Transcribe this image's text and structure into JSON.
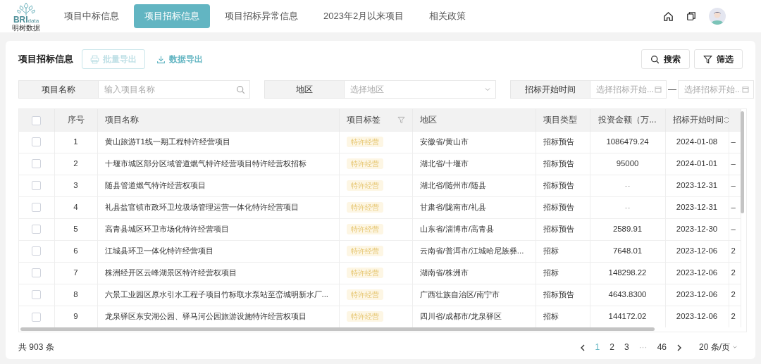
{
  "nav": {
    "logo": {
      "text": "BRI",
      "suffix": "data",
      "caption": "明树数据"
    },
    "tabs": [
      {
        "label": "项目中标信息",
        "selected": false
      },
      {
        "label": "项目招标信息",
        "selected": true
      },
      {
        "label": "项目招标异常信息",
        "selected": false
      },
      {
        "label": "2023年2月以来项目",
        "selected": false
      },
      {
        "label": "相关政策",
        "selected": false
      }
    ]
  },
  "panel": {
    "title": "项目招标信息",
    "buttons": [
      {
        "label": "批量导出",
        "kind": "print",
        "disabled": true
      },
      {
        "label": "数据导出",
        "kind": "download",
        "disabled": false
      }
    ],
    "actions": [
      {
        "label": "搜索",
        "kind": "search"
      },
      {
        "label": "筛选",
        "kind": "filter"
      }
    ]
  },
  "filters": [
    {
      "label": "项目名称",
      "kind": "text",
      "placeholder": "输入项目名称"
    },
    {
      "label": "地区",
      "kind": "select",
      "placeholder": "选择地区"
    },
    {
      "label": "招标开始时间",
      "kind": "daterange",
      "start_placeholder": "选择招标开始...",
      "separator": "—",
      "end_placeholder": "选择招标开始..."
    }
  ],
  "table": {
    "header_checked": false,
    "columns": [
      {
        "kind": "checkbox"
      },
      {
        "kind": "index",
        "label": "序号"
      },
      {
        "kind": "text",
        "label": "项目名称"
      },
      {
        "kind": "tag",
        "label": "项目标签",
        "filter": true
      },
      {
        "kind": "text",
        "label": "地区"
      },
      {
        "kind": "text",
        "label": "项目类型"
      },
      {
        "kind": "number",
        "label": "投资金额（万..."
      },
      {
        "kind": "date",
        "label": "招标开始时间",
        "sortable": true
      },
      {
        "kind": "cut"
      }
    ],
    "rows": [
      {
        "checked": false,
        "cells": [
          "",
          "1",
          "黄山旅游T1线一期工程特许经营项目",
          "特许经营",
          "安徽省/黄山市",
          "招标预告",
          "1086479.24",
          "2024-01-08",
          "–"
        ]
      },
      {
        "checked": false,
        "cells": [
          "",
          "2",
          "十堰市城区部分区域管道燃气特许经营项目特许经营权招标",
          "特许经营",
          "湖北省/十堰市",
          "招标预告",
          "95000",
          "2024-01-01",
          "–"
        ]
      },
      {
        "checked": false,
        "cells": [
          "",
          "3",
          "随县管道燃气特许经营权项目",
          "特许经营",
          "湖北省/随州市/随县",
          "招标预告",
          "--",
          "2023-12-31",
          "–"
        ]
      },
      {
        "checked": false,
        "cells": [
          "",
          "4",
          "礼县盐官镇市政环卫垃圾场管理运营一体化特许经营项目",
          "特许经营",
          "甘肃省/陇南市/礼县",
          "招标预告",
          "--",
          "2023-12-31",
          "–"
        ]
      },
      {
        "checked": false,
        "cells": [
          "",
          "5",
          "高青县城区环卫市场化特许经营项目",
          "特许经营",
          "山东省/淄博市/高青县",
          "招标预告",
          "2589.91",
          "2023-12-30",
          "–"
        ]
      },
      {
        "checked": false,
        "cells": [
          "",
          "6",
          "江城县环卫一体化特许经营项目",
          "特许经营",
          "云南省/普洱市/江城哈尼族彝...",
          "招标",
          "7648.01",
          "2023-12-06",
          "2"
        ]
      },
      {
        "checked": false,
        "cells": [
          "",
          "7",
          "株洲经开区云峰湖景区特许经营权项目",
          "特许经营",
          "湖南省/株洲市",
          "招标",
          "148298.22",
          "2023-12-06",
          "2"
        ]
      },
      {
        "checked": false,
        "cells": [
          "",
          "8",
          "六景工业园区原水引水工程子项目竹标取水泵站至峦城明新水厂...",
          "特许经营",
          "广西壮族自治区/南宁市",
          "招标预告",
          "4643.8300",
          "2023-12-06",
          "2"
        ]
      },
      {
        "checked": false,
        "cells": [
          "",
          "9",
          "龙泉驿区东安湖公园、驿马河公园旅游设施特许经营权项目",
          "特许经营",
          "四川省/成都市/龙泉驿区",
          "招标",
          "144172.02",
          "2023-12-06",
          "2"
        ]
      }
    ]
  },
  "footer": {
    "total": "共 903 条",
    "pages": [
      {
        "label": "1",
        "kind": "page",
        "selected": true
      },
      {
        "label": "2",
        "kind": "page",
        "selected": false
      },
      {
        "label": "3",
        "kind": "page",
        "selected": false
      },
      {
        "label": "···",
        "kind": "ellipsis"
      },
      {
        "label": "46",
        "kind": "page",
        "selected": false
      }
    ],
    "page_size": "20 条/页"
  }
}
